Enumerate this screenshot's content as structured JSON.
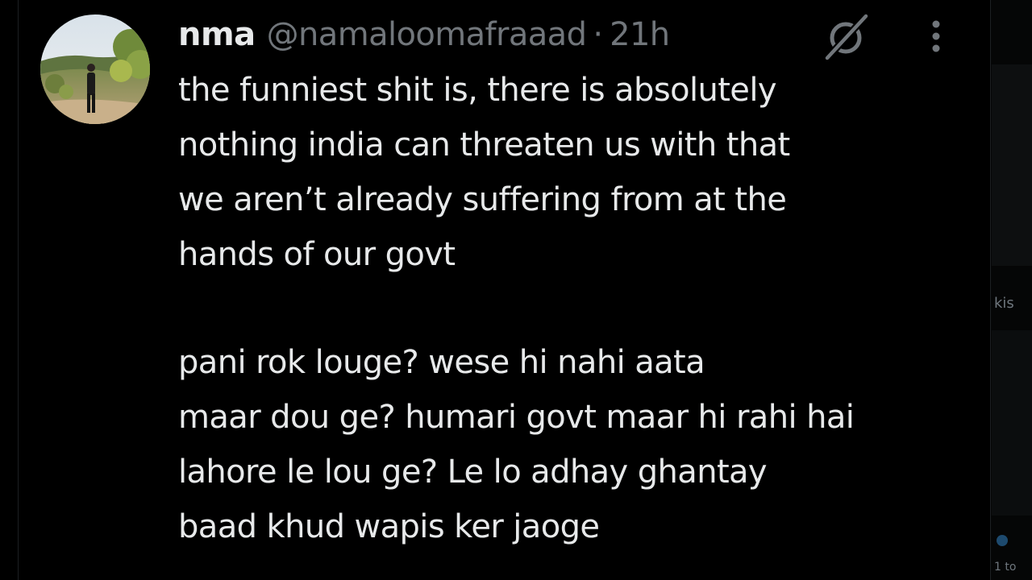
{
  "tweet": {
    "author": {
      "display_name": "nma",
      "handle": "@namaloomafraaad",
      "avatar_icon": "profile-photo-icon"
    },
    "separator": "·",
    "time": "21h",
    "actions": {
      "grok_icon": "grok-slash-icon",
      "more_icon": "more-options-icon"
    },
    "lines": [
      "the funniest shit is, there is absolutely",
      "nothing india can threaten us with that",
      "we aren’t already suffering from at the",
      "hands of our govt",
      "",
      "pani rok louge? wese hi nahi aata",
      "maar dou ge? humari govt maar hi rahi hai",
      "lahore le lou ge? Le lo adhay ghantay",
      "baad khud wapis ker jaoge"
    ]
  },
  "sidebar_fragments": {
    "snippet_1": "kis",
    "snippet_2": "1 to"
  },
  "colors": {
    "background": "#000000",
    "primary_text": "#e7e9ea",
    "secondary_text": "#71767b"
  }
}
